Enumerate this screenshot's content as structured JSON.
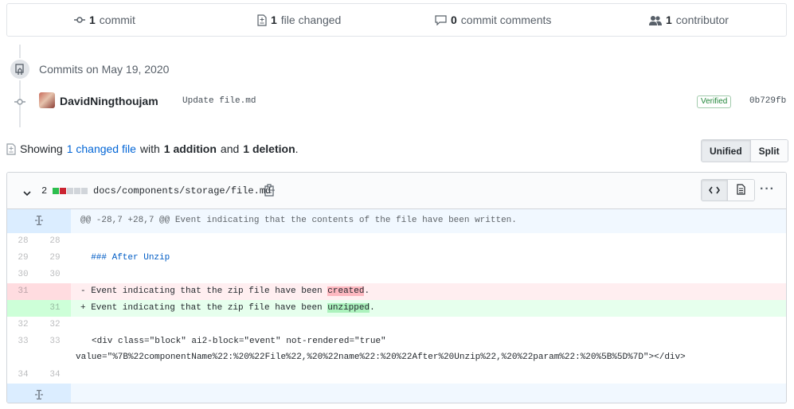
{
  "summary": {
    "commits_count": "1",
    "commits_label": "commit",
    "files_count": "1",
    "files_label": "file changed",
    "comments_count": "0",
    "comments_label": "commit comments",
    "contributors_count": "1",
    "contributors_label": "contributor"
  },
  "commits": {
    "date_heading": "Commits on May 19, 2020",
    "author": "DavidNingthoujam",
    "message": "Update file.md",
    "verified_label": "Verified",
    "sha": "0b729fb"
  },
  "showing": {
    "prefix": "Showing",
    "changed_link": "1 changed file",
    "with": "with",
    "additions": "1 addition",
    "and": "and",
    "deletions": "1 deletion",
    "period": "."
  },
  "view_toggle": {
    "unified": "Unified",
    "split": "Split"
  },
  "file": {
    "diffstat_count": "2",
    "path": "docs/components/storage/file.md",
    "colors": {
      "add": "#2cbe4e",
      "del": "#cb2431",
      "neutral": "#d1d5da"
    },
    "hunk_header": "@@ -28,7 +28,7 @@ Event indicating that the contents of the file have been written.",
    "lines": [
      {
        "type": "ctx",
        "old": "28",
        "new": "28",
        "text": ""
      },
      {
        "type": "ctx",
        "old": "29",
        "new": "29",
        "text": "### After Unzip"
      },
      {
        "type": "ctx",
        "old": "30",
        "new": "30",
        "text": ""
      },
      {
        "type": "del",
        "old": "31",
        "new": "",
        "prefix": "- Event indicating that the zip file have been ",
        "highlight": "created",
        "suffix": "."
      },
      {
        "type": "add",
        "old": "",
        "new": "31",
        "prefix": "+ Event indicating that the zip file have been ",
        "highlight": "unzipped",
        "suffix": "."
      },
      {
        "type": "ctx",
        "old": "32",
        "new": "32",
        "text": ""
      },
      {
        "type": "ctx",
        "old": "33",
        "new": "33",
        "text": "<div class=\"block\" ai2-block=\"event\" not-rendered=\"true\"",
        "text2": "value=\"%7B%22componentName%22:%20%22File%22,%20%22name%22:%20%22After%20Unzip%22,%20%22param%22:%20%5B%5D%7D\"></div>"
      },
      {
        "type": "ctx",
        "old": "34",
        "new": "34",
        "text": ""
      }
    ]
  }
}
